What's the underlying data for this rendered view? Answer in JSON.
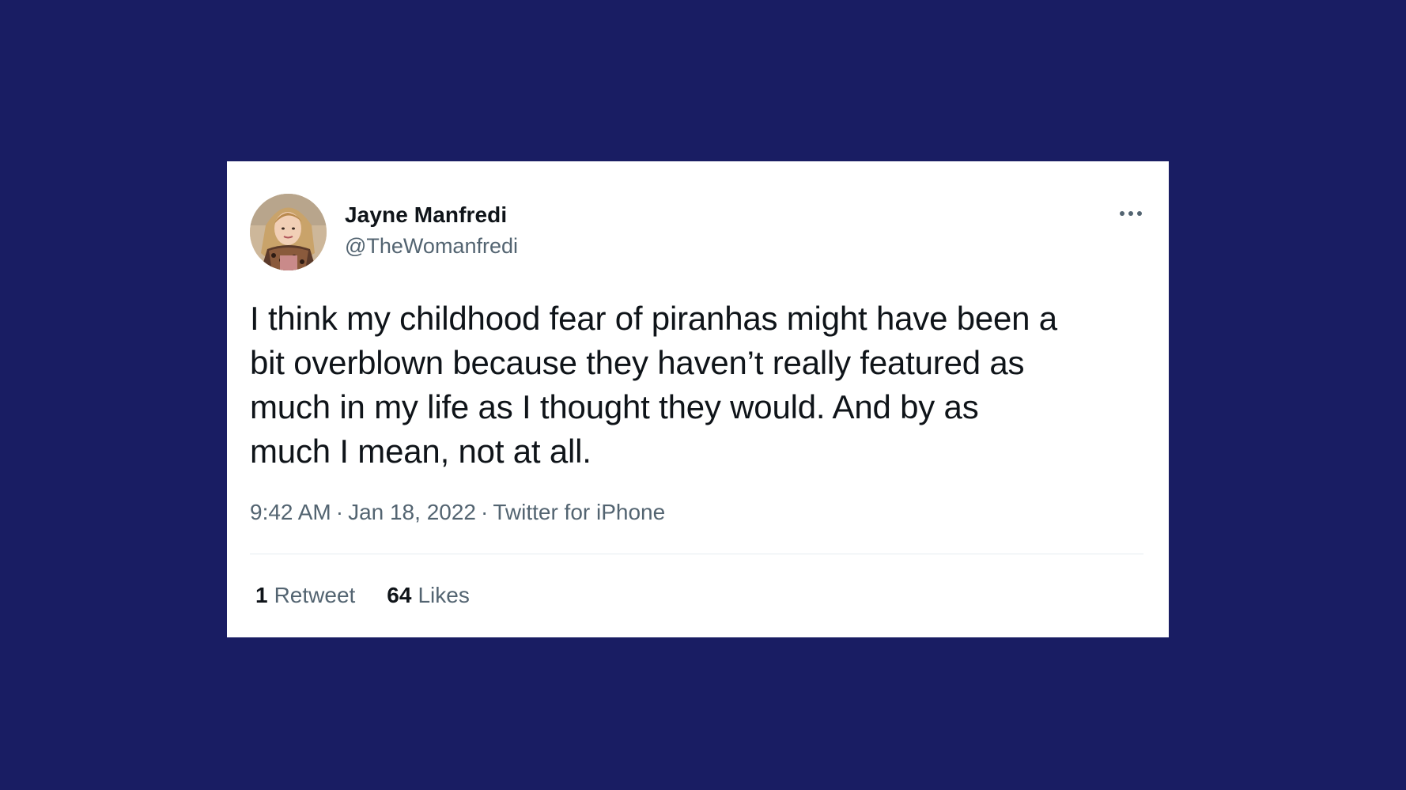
{
  "colors": {
    "background": "#191d63",
    "card": "#ffffff",
    "primary_text": "#0f1419",
    "secondary_text": "#536471",
    "divider": "#e6ecf0"
  },
  "author": {
    "display_name": "Jayne Manfredi",
    "handle": "@TheWomanfredi",
    "avatar_icon": "profile-photo"
  },
  "tweet": {
    "text": "I think my childhood fear of piranhas might have been a\nbit overblown because they haven’t really featured as\nmuch in my life as I thought they would. And by as\nmuch I mean, not at all.",
    "time": "9:42 AM",
    "separator": "·",
    "date": "Jan 18, 2022",
    "source": "Twitter for iPhone"
  },
  "stats": {
    "retweets_count": "1",
    "retweets_label": "Retweet",
    "likes_count": "64",
    "likes_label": "Likes"
  },
  "more_icon": "more-horizontal-icon"
}
